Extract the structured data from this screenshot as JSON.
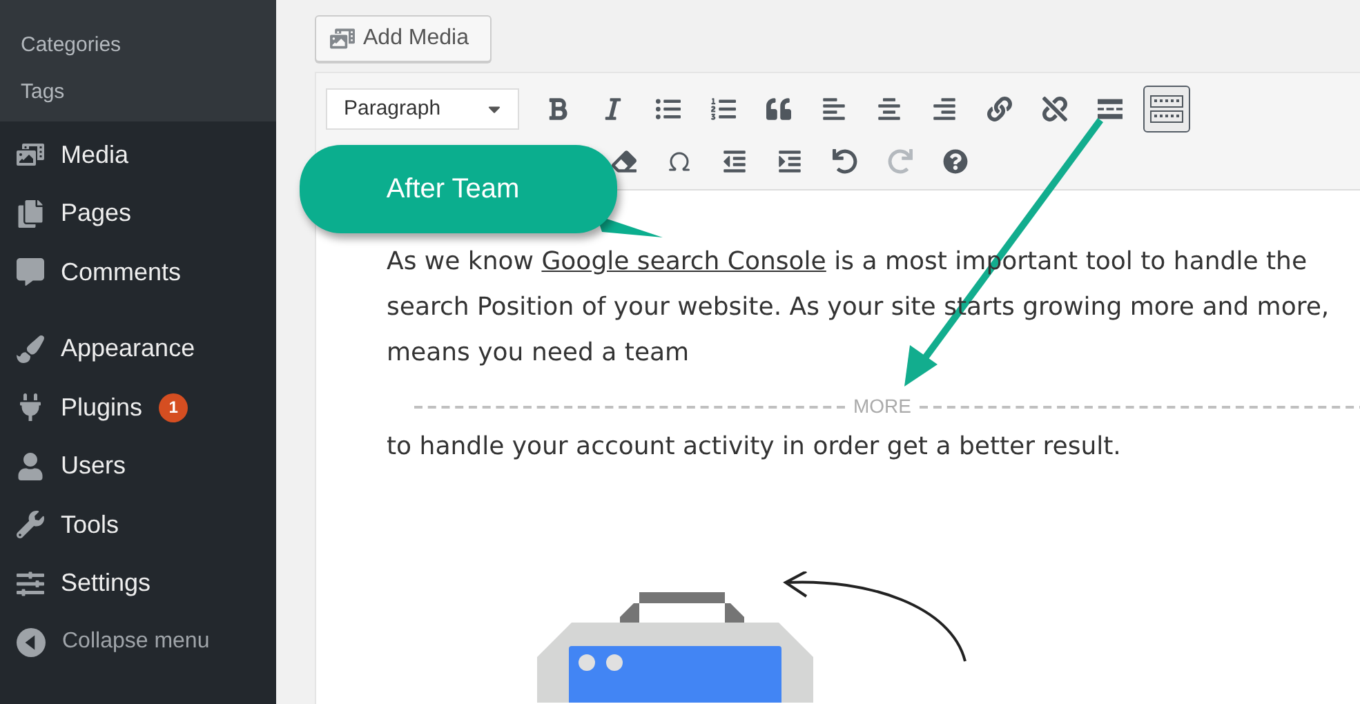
{
  "sidebar": {
    "submenu": [
      {
        "label": "Categories"
      },
      {
        "label": "Tags"
      }
    ],
    "menu_groups": [
      [
        {
          "label": "Media"
        },
        {
          "label": "Pages"
        },
        {
          "label": "Comments"
        }
      ],
      [
        {
          "label": "Appearance"
        },
        {
          "label": "Plugins",
          "badge": "1"
        },
        {
          "label": "Users"
        },
        {
          "label": "Tools"
        },
        {
          "label": "Settings"
        }
      ]
    ],
    "collapse": "Collapse menu"
  },
  "add_media": "Add Media",
  "toolbar": {
    "format": "Paragraph",
    "toolbar_toggle": {
      "pressed": true
    },
    "redo": {
      "disabled": true
    }
  },
  "content": {
    "paragraph_1": {
      "before": "As we know ",
      "link": "Google search Console",
      "after": " is a most important tool to handle the search Position of your website. As your site starts growing more and more, means you need a team"
    },
    "more_tag": "MORE",
    "paragraph_2": "to handle your account activity in order get a better result."
  },
  "callout": {
    "label": "After Team"
  }
}
